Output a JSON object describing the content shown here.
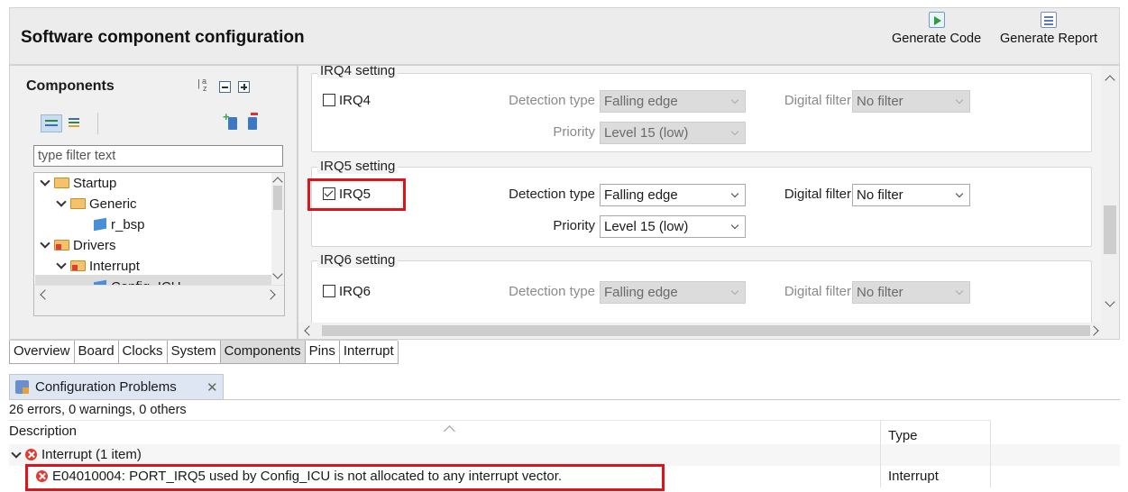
{
  "header": {
    "title": "Software component configuration",
    "generate_code": "Generate Code",
    "generate_report": "Generate Report"
  },
  "components": {
    "title": "Components",
    "filter_placeholder": "type filter text",
    "tree": [
      {
        "label": "Startup",
        "type": "folder",
        "expanded": true
      },
      {
        "label": "Generic",
        "type": "folder",
        "expanded": true
      },
      {
        "label": "r_bsp",
        "type": "component"
      },
      {
        "label": "Drivers",
        "type": "folder",
        "expanded": true,
        "error": true
      },
      {
        "label": "Interrupt",
        "type": "folder",
        "expanded": true,
        "error": true
      },
      {
        "label": "Config_ICU",
        "type": "component",
        "error": true,
        "selected": true
      }
    ]
  },
  "settings": {
    "groups": [
      {
        "title": "IRQ4 setting",
        "checkbox_label": "IRQ4",
        "checked": false,
        "detection_label": "Detection type",
        "detection_value": "Falling edge",
        "filter_label": "Digital filter",
        "filter_value": "No filter",
        "priority_label": "Priority",
        "priority_value": "Level 15 (low)"
      },
      {
        "title": "IRQ5 setting",
        "checkbox_label": "IRQ5",
        "checked": true,
        "detection_label": "Detection type",
        "detection_value": "Falling edge",
        "filter_label": "Digital filter",
        "filter_value": "No filter",
        "priority_label": "Priority",
        "priority_value": "Level 15 (low)"
      },
      {
        "title": "IRQ6 setting",
        "checkbox_label": "IRQ6",
        "checked": false,
        "detection_label": "Detection type",
        "detection_value": "Falling edge",
        "filter_label": "Digital filter",
        "filter_value": "No filter"
      }
    ]
  },
  "tabs": [
    "Overview",
    "Board",
    "Clocks",
    "System",
    "Components",
    "Pins",
    "Interrupt"
  ],
  "active_tab": "Components",
  "problems": {
    "tab_label": "Configuration Problems",
    "close_glyph": "✕",
    "summary": "26 errors, 0 warnings, 0 others",
    "col_description": "Description",
    "col_type": "Type",
    "group_label": "Interrupt (1 item)",
    "error_message": "E04010004: PORT_IRQ5 used by Config_ICU is not allocated to any interrupt vector.",
    "error_type": "Interrupt"
  },
  "colors": {
    "highlight": "#e0131b",
    "error": "#e0392f"
  }
}
